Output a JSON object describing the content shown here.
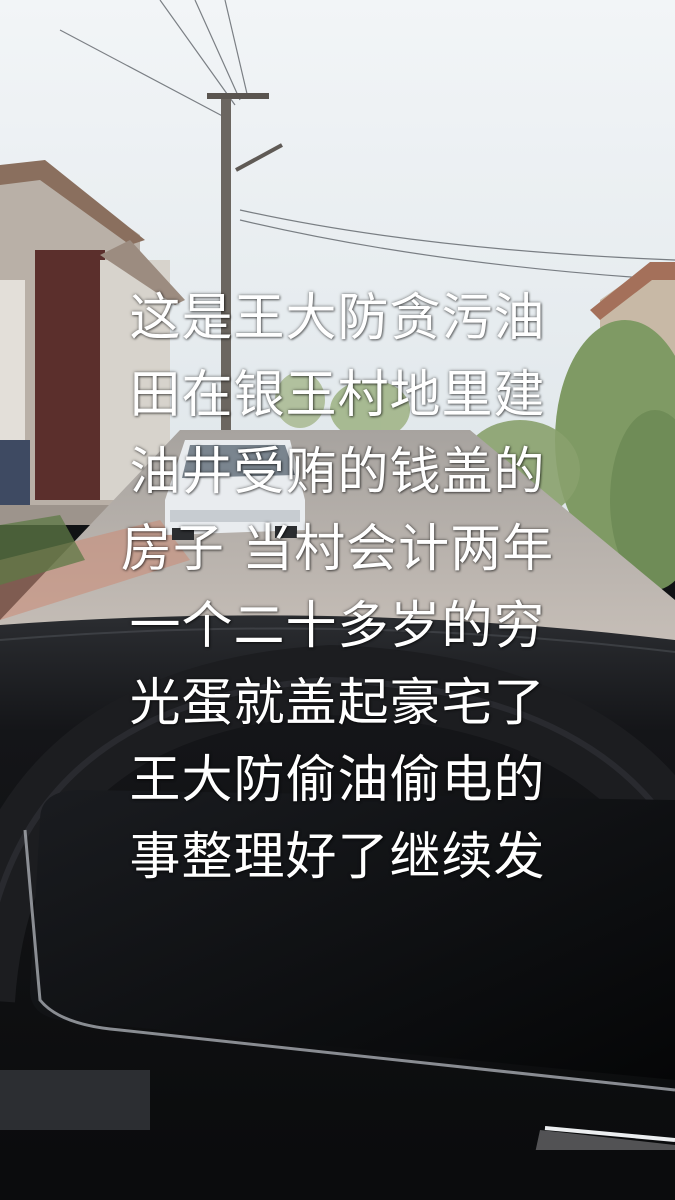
{
  "caption": {
    "lines": [
      "这是王大防贪污油",
      "田在银王村地里建",
      "油井受贿的钱盖的",
      "房子 当村会计两年",
      "一个二十多岁的穷",
      "光蛋就盖起豪宅了",
      "王大防偷油偷电的",
      "事整理好了继续发"
    ]
  },
  "scene": {
    "sky_color": "#e4ebef",
    "road_color": "#b9b3ad",
    "dashboard_color": "#0c0d0f"
  }
}
